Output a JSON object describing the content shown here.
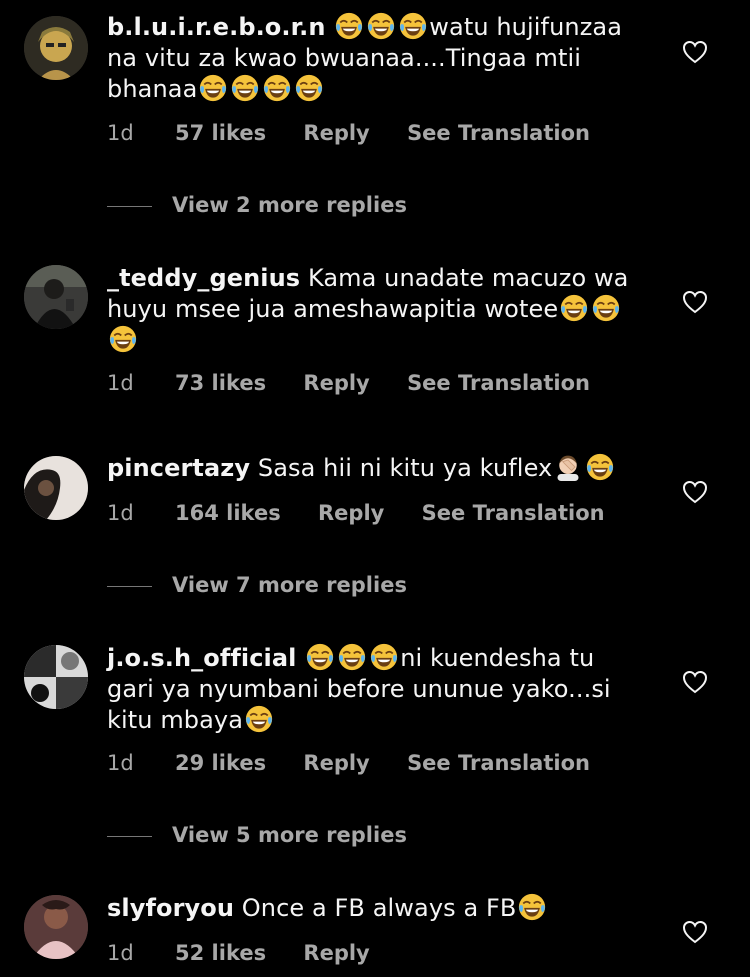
{
  "comments": [
    {
      "username": "b.l.u.i.r.e.b.o.r.n",
      "text_before": "",
      "emoji_lead": "😂😂😂",
      "text": "watu hujifunzaa na vitu za kwao bwuanaa....Tingaa mtii bhanaa",
      "emoji_tail": "😂😂😂😂",
      "time": "1d",
      "likes": "57 likes",
      "reply": "Reply",
      "translate": "See Translation",
      "view_more": "View 2 more replies"
    },
    {
      "username": "_teddy_genius",
      "text": "Kama unadate macuzo wa huyu msee jua ameshawapitia wotee",
      "emoji_tail": "😂😂😂",
      "time": "1d",
      "likes": "73 likes",
      "reply": "Reply",
      "translate": "See Translation"
    },
    {
      "username": "pincertazy",
      "text": "Sasa hii ni kitu ya kuflex",
      "emoji_tail": "🤦🏻‍♂️😂",
      "time": "1d",
      "likes": "164 likes",
      "reply": "Reply",
      "translate": "See Translation",
      "view_more": "View 7 more replies"
    },
    {
      "username": "j.o.s.h_official",
      "emoji_lead": "😂😂😂",
      "text": "ni kuendesha tu gari ya nyumbani before ununue yako...si kitu mbaya",
      "emoji_tail": "😂",
      "time": "1d",
      "likes": "29 likes",
      "reply": "Reply",
      "translate": "See Translation",
      "view_more": "View 5 more replies"
    },
    {
      "username": "slyforyou",
      "text": "Once a FB always a FB",
      "emoji_tail": "😂",
      "time": "1d",
      "likes": "52 likes",
      "reply": "Reply"
    }
  ],
  "icons": {
    "like": "heart-outline-icon"
  },
  "colors": {
    "background": "#000000",
    "text": "#f5f5f5",
    "meta": "#a8a8a8"
  }
}
